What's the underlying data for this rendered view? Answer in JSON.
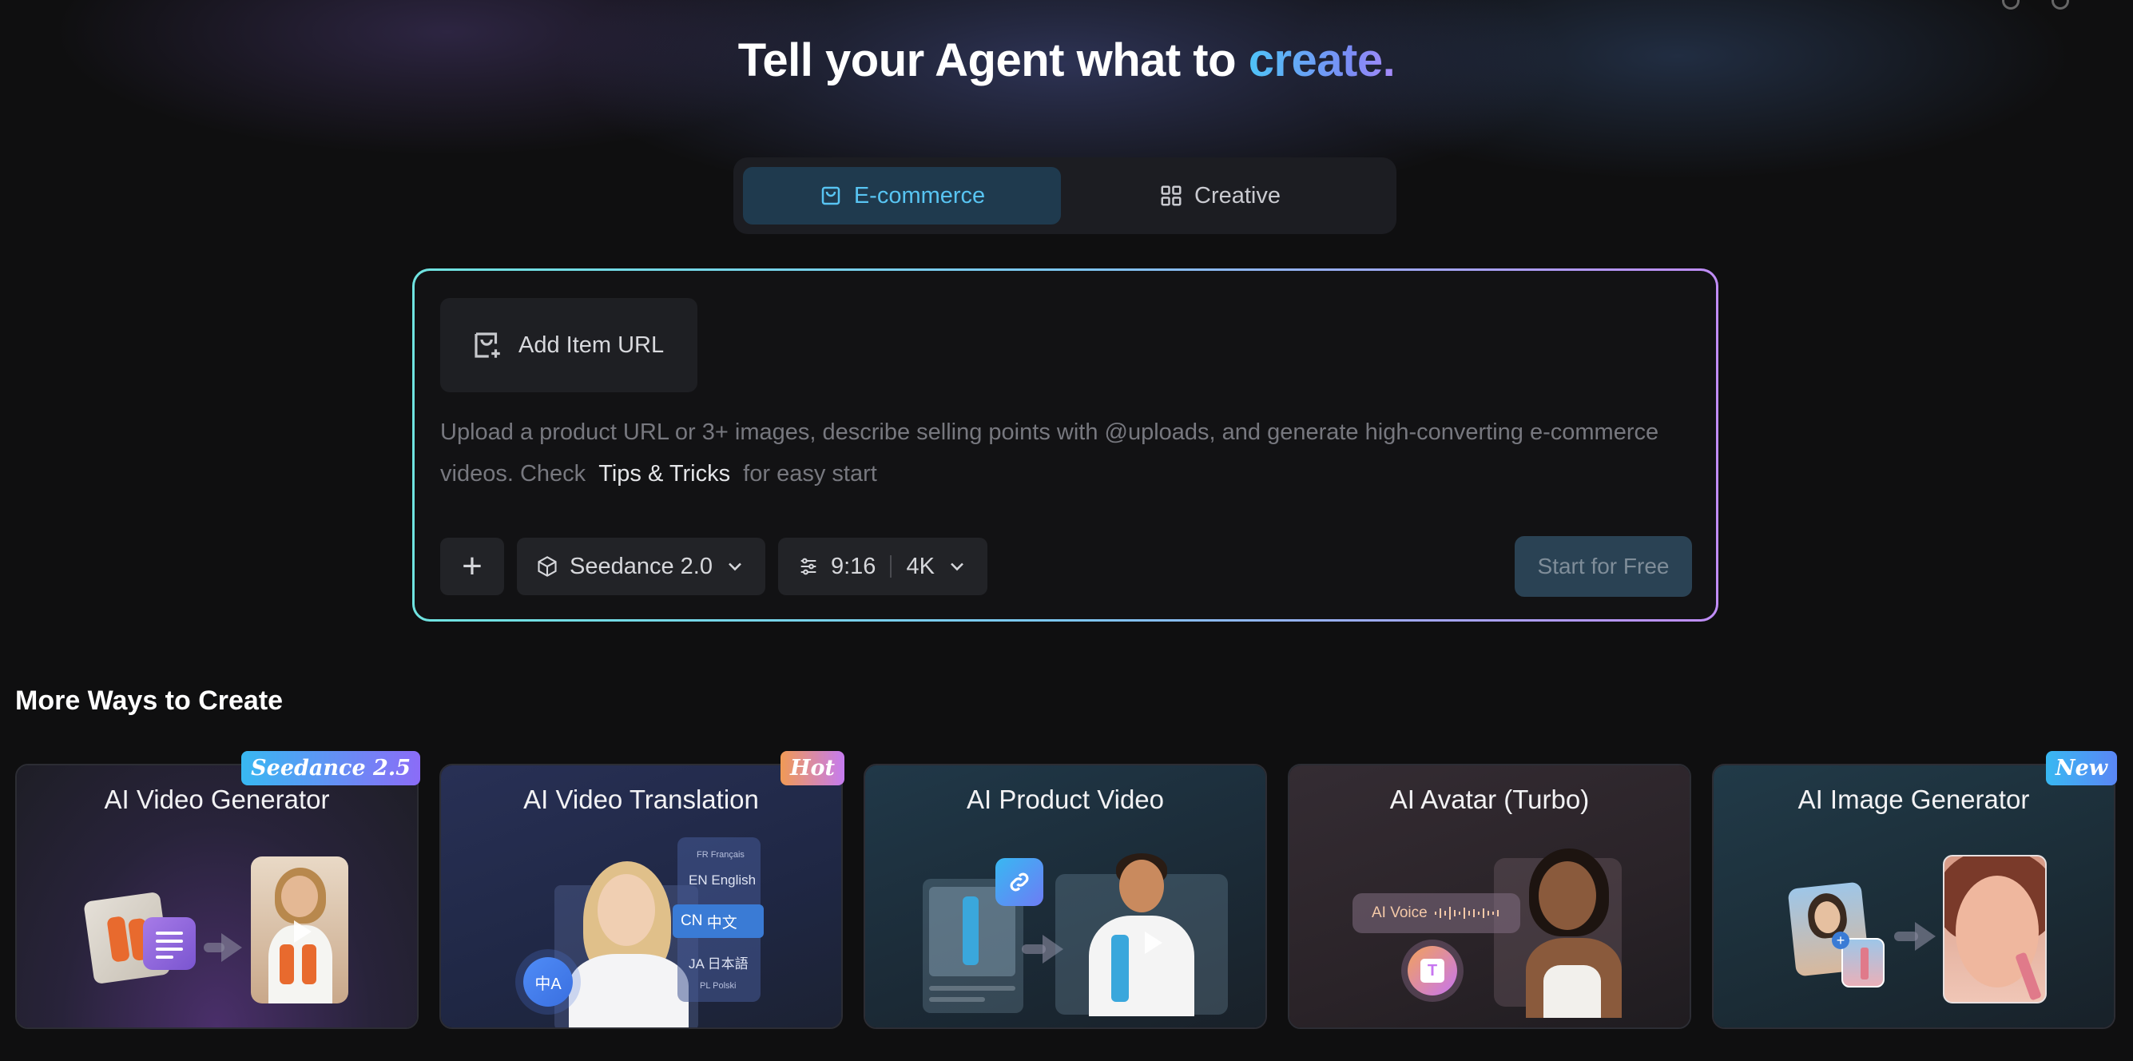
{
  "headline": {
    "prefix": "Tell your Agent what to",
    "accent": "create."
  },
  "mode_switch": {
    "tabs": [
      {
        "label": "E-commerce",
        "icon": "bag-icon",
        "active": true
      },
      {
        "label": "Creative",
        "icon": "grid-icon",
        "active": false
      }
    ]
  },
  "composer": {
    "add_item_url_label": "Add Item URL",
    "prompt_text_part1": "Upload a product URL or 3+ images, describe selling points with @uploads, and generate high-converting e-commerce videos. Check",
    "tips_link": "Tips & Tricks",
    "prompt_text_part2": "for easy start",
    "add_button_label": "+",
    "model_label": "Seedance 2.0",
    "aspect_ratio": "9:16",
    "resolution": "4K",
    "start_button_label": "Start for Free"
  },
  "more_ways": {
    "section_title": "More Ways to Create",
    "cards": [
      {
        "title": "AI Video Generator",
        "badge": "Seedance 2.5"
      },
      {
        "title": "AI Video Translation",
        "badge": "Hot"
      },
      {
        "title": "AI Product Video",
        "badge": ""
      },
      {
        "title": "AI Avatar (Turbo)",
        "badge": ""
      },
      {
        "title": "AI Image Generator",
        "badge": "New"
      }
    ],
    "translation_languages": [
      {
        "code": "FR",
        "name": "Français"
      },
      {
        "code": "EN",
        "name": "English"
      },
      {
        "code": "CN",
        "name": "中文"
      },
      {
        "code": "JA",
        "name": "日本語"
      },
      {
        "code": "PL",
        "name": "Polski"
      }
    ],
    "translate_icon_text": "中A",
    "voice_label": "AI Voice",
    "voice_t_icon": "T"
  },
  "colors": {
    "accent_blue": "#58c4f2",
    "accent_purple": "#a78bfa",
    "background": "#0f0f10"
  }
}
